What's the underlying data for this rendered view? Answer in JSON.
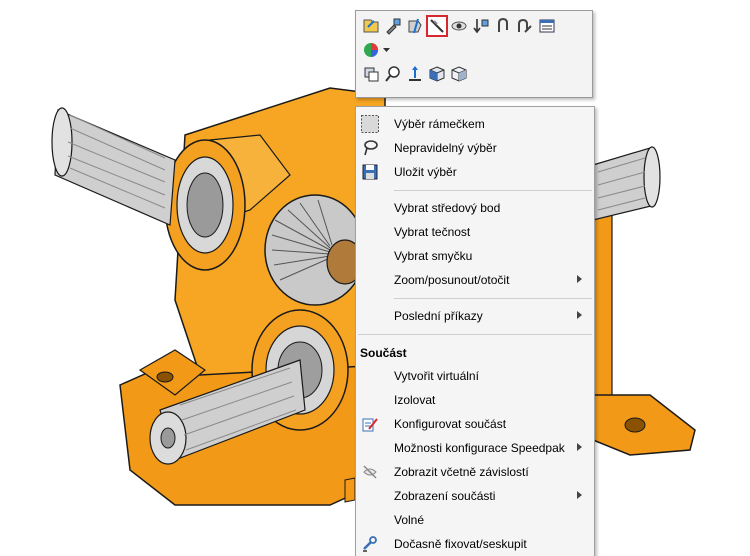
{
  "toolbar": {
    "row1": [
      {
        "icon": "open-part-icon"
      },
      {
        "icon": "edit-component-icon"
      },
      {
        "icon": "hide-component-icon"
      },
      {
        "icon": "suppress-icon",
        "selected": true
      },
      {
        "icon": "change-transparency-icon"
      },
      {
        "icon": "view-mates-icon"
      },
      {
        "icon": "mate-icon"
      },
      {
        "icon": "smart-mates-icon"
      },
      {
        "icon": "properties-list-icon"
      }
    ],
    "row2": [
      {
        "icon": "appearance-icon"
      }
    ],
    "row3": [
      {
        "icon": "rotate-component-icon"
      },
      {
        "icon": "zoom-to-selection-icon"
      },
      {
        "icon": "normal-to-icon"
      },
      {
        "icon": "isometric-view-icon"
      },
      {
        "icon": "shaded-view-icon"
      }
    ]
  },
  "menu": {
    "items_top": [
      {
        "label": "Výběr rámečkem",
        "icon": "box-select-icon"
      },
      {
        "label": "Nepravidelný výběr",
        "icon": "lasso-select-icon"
      },
      {
        "label": "Uložit výběr",
        "icon": "save-selection-icon"
      }
    ],
    "items_mid": [
      {
        "label": "Vybrat středový bod"
      },
      {
        "label": "Vybrat tečnost"
      },
      {
        "label": "Vybrat smyčku"
      },
      {
        "label": "Zoom/posunout/otočit",
        "submenu": true
      }
    ],
    "recent": {
      "label": "Poslední příkazy",
      "submenu": true
    },
    "section_header": "Součást",
    "items_part": [
      {
        "label": "Vytvořit virtuální"
      },
      {
        "label": "Izolovat"
      },
      {
        "label": "Konfigurovat součást",
        "icon": "configure-component-icon"
      },
      {
        "label": "Možnosti konfigurace Speedpak",
        "submenu": true
      },
      {
        "label": "Zobrazit včetně závislostí",
        "icon": "show-with-dependents-icon"
      },
      {
        "label": "Zobrazení součásti",
        "submenu": true
      },
      {
        "label": "Volné"
      },
      {
        "label": "Dočasně fixovat/seskupit",
        "icon": "temporary-fix-icon"
      }
    ]
  }
}
